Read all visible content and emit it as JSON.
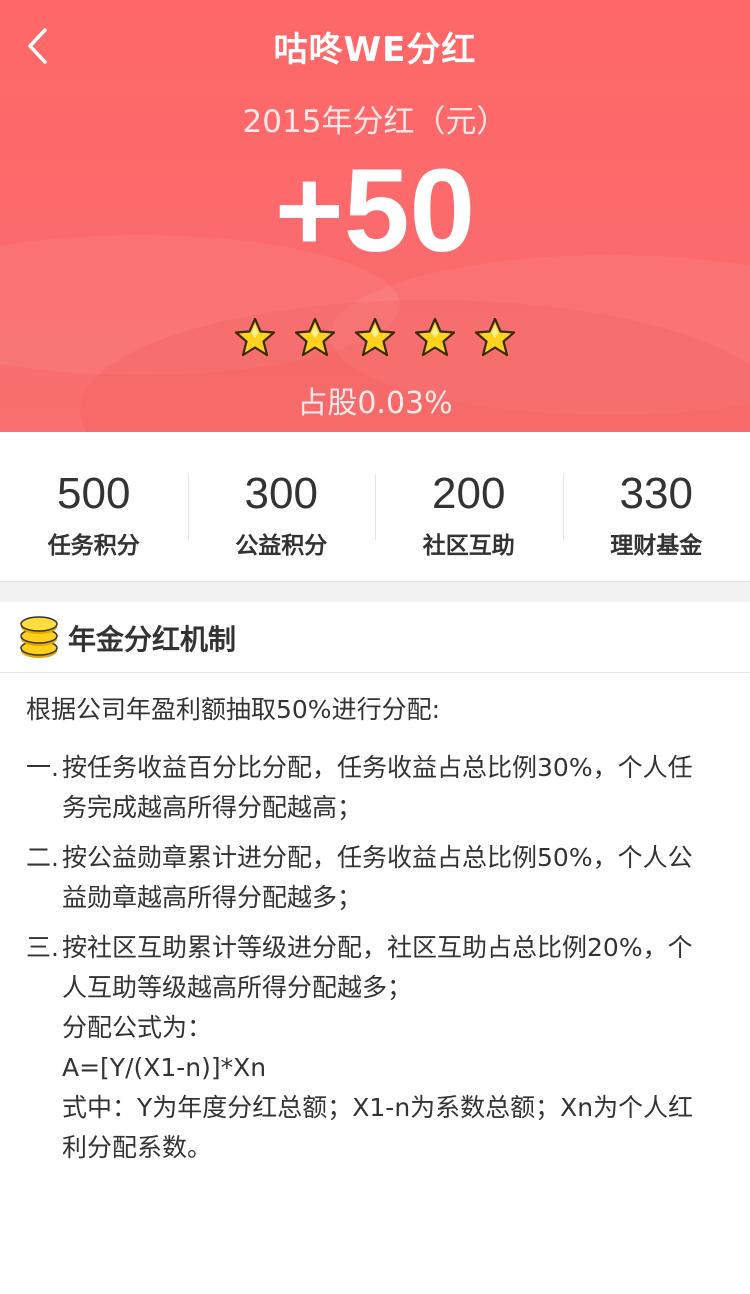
{
  "nav": {
    "title": "咕咚WE分红",
    "back_icon": "chevron-left-icon"
  },
  "hero": {
    "year_label": "2015年分红（元）",
    "amount": "+50",
    "stars": 5,
    "share_label": "占股0.03%"
  },
  "stats": [
    {
      "value": "500",
      "label": "任务积分"
    },
    {
      "value": "300",
      "label": "公益积分"
    },
    {
      "value": "200",
      "label": "社区互助"
    },
    {
      "value": "330",
      "label": "理财基金"
    }
  ],
  "section": {
    "title": "年金分红机制",
    "icon": "coin-stack-icon"
  },
  "content": {
    "intro": "根据公司年盈利额抽取50%进行分配:",
    "rules": [
      {
        "num": "一.",
        "lines": [
          "按任务收益百分比分配，任务收益占总比例30%，个人任",
          "务完成越高所得分配越高；"
        ]
      },
      {
        "num": "二.",
        "lines": [
          "按公益勋章累计进分配，任务收益占总比例50%，个人公",
          "益勋章越高所得分配越多；"
        ]
      },
      {
        "num": "三.",
        "lines": [
          "按社区互助累计等级进分配，社区互助占总比例20%，个",
          "人互助等级越高所得分配越多；",
          "分配公式为：",
          "A=[Y/(X1-n)]*Xn",
          "式中：Y为年度分红总额；X1-n为系数总额；Xn为个人红",
          "利分配系数。"
        ]
      }
    ]
  },
  "colors": {
    "hero": "#ff6867",
    "star": "#ffd21f",
    "coin": "#f5c400"
  }
}
